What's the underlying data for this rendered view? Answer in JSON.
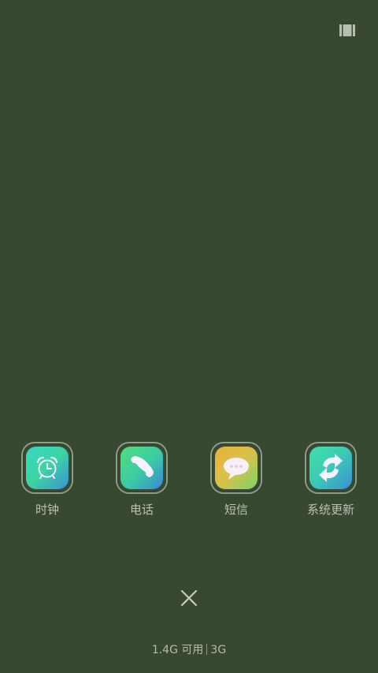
{
  "recents": {
    "apps": [
      {
        "label": "时钟",
        "icon": "alarm-clock-icon"
      },
      {
        "label": "电话",
        "icon": "phone-handset-icon"
      },
      {
        "label": "短信",
        "icon": "speech-bubble-icon"
      },
      {
        "label": "系统更新",
        "icon": "refresh-arrows-icon"
      }
    ]
  },
  "memory": {
    "available": "1.4G 可用",
    "total": "3G"
  },
  "colors": {
    "background": "#384831",
    "label": "#b9c2b4"
  }
}
